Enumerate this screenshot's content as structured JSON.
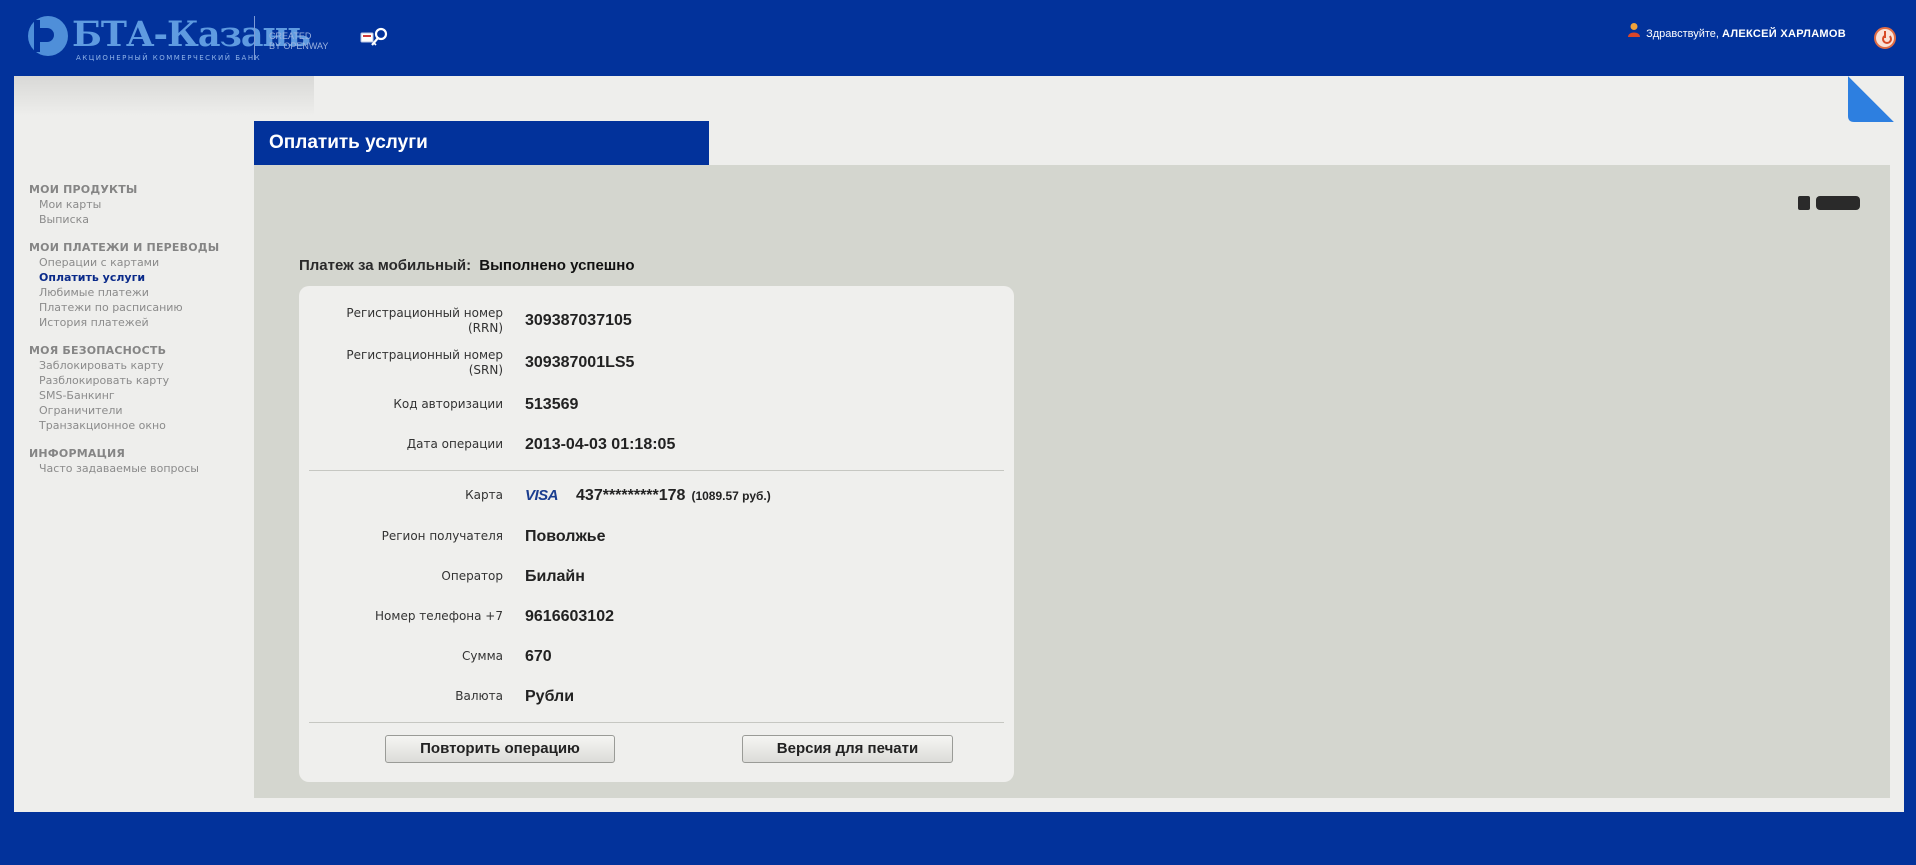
{
  "header": {
    "logo_text": "БТА-Казань",
    "logo_sub": "АКЦИОНЕРНЫЙ КОММЕРЧЕСКИЙ БАНК",
    "created_line1": "CREATED",
    "created_line2": "BY OPENWAY",
    "greeting": "Здравствуйте,",
    "user_name": "АЛЕКСЕЙ ХАРЛАМОВ"
  },
  "sidebar": {
    "groups": [
      {
        "title": "МОИ ПРОДУКТЫ",
        "items": [
          "Мои карты",
          "Выписка"
        ]
      },
      {
        "title": "МОИ ПЛАТЕЖИ И ПЕРЕВОДЫ",
        "items": [
          "Операции с картами",
          "Оплатить услуги",
          "Любимые платежи",
          "Платежи по расписанию",
          "История платежей"
        ]
      },
      {
        "title": "МОЯ БЕЗОПАСНОСТЬ",
        "items": [
          "Заблокировать карту",
          "Разблокировать карту",
          "SMS-Банкинг",
          "Ограничители",
          "Транзакционное окно"
        ]
      },
      {
        "title": "ИНФОРМАЦИЯ",
        "items": [
          "Часто задаваемые вопросы"
        ]
      }
    ],
    "active_item": "Оплатить услуги"
  },
  "page": {
    "title": "Оплатить услуги",
    "status_label": "Платеж за мобильный:",
    "status_value": "Выполнено успешно"
  },
  "details": {
    "rrn_label_1": "Регистрационный номер",
    "rrn_label_2": "(RRN)",
    "rrn_value": "309387037105",
    "srn_label_1": "Регистрационный номер",
    "srn_label_2": "(SRN)",
    "srn_value": "309387001LS5",
    "auth_label": "Код авторизации",
    "auth_value": "513569",
    "date_label": "Дата операции",
    "date_value": "2013-04-03 01:18:05",
    "card_label": "Карта",
    "card_brand": "VISA",
    "card_number": "437*********178",
    "card_balance": "(1089.57 руб.)",
    "region_label": "Регион получателя",
    "region_value": "Поволжье",
    "operator_label": "Оператор",
    "operator_value": "Билайн",
    "phone_label": "Номер телефона +7",
    "phone_value": "9616603102",
    "amount_label": "Сумма",
    "amount_value": "670",
    "currency_label": "Валюта",
    "currency_value": "Рубли"
  },
  "buttons": {
    "repeat": "Повторить операцию",
    "print": "Версия для печати"
  },
  "colors": {
    "brand_blue": "#02329b",
    "panel_grey": "#d4d6cf",
    "card_bg": "#efefed",
    "active_nav": "#0a2a8a"
  }
}
